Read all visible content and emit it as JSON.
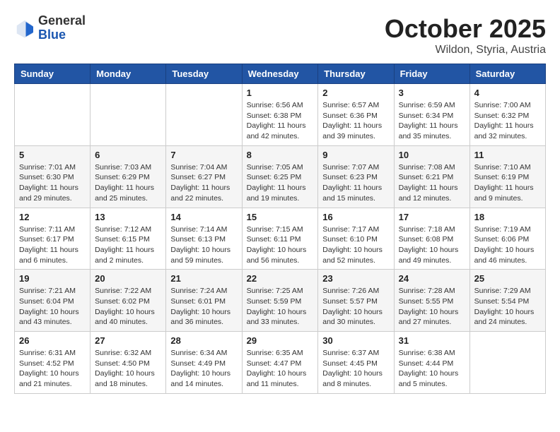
{
  "header": {
    "logo_general": "General",
    "logo_blue": "Blue",
    "month": "October 2025",
    "location": "Wildon, Styria, Austria"
  },
  "weekdays": [
    "Sunday",
    "Monday",
    "Tuesday",
    "Wednesday",
    "Thursday",
    "Friday",
    "Saturday"
  ],
  "weeks": [
    [
      {
        "day": "",
        "info": ""
      },
      {
        "day": "",
        "info": ""
      },
      {
        "day": "",
        "info": ""
      },
      {
        "day": "1",
        "info": "Sunrise: 6:56 AM\nSunset: 6:38 PM\nDaylight: 11 hours and 42 minutes."
      },
      {
        "day": "2",
        "info": "Sunrise: 6:57 AM\nSunset: 6:36 PM\nDaylight: 11 hours and 39 minutes."
      },
      {
        "day": "3",
        "info": "Sunrise: 6:59 AM\nSunset: 6:34 PM\nDaylight: 11 hours and 35 minutes."
      },
      {
        "day": "4",
        "info": "Sunrise: 7:00 AM\nSunset: 6:32 PM\nDaylight: 11 hours and 32 minutes."
      }
    ],
    [
      {
        "day": "5",
        "info": "Sunrise: 7:01 AM\nSunset: 6:30 PM\nDaylight: 11 hours and 29 minutes."
      },
      {
        "day": "6",
        "info": "Sunrise: 7:03 AM\nSunset: 6:29 PM\nDaylight: 11 hours and 25 minutes."
      },
      {
        "day": "7",
        "info": "Sunrise: 7:04 AM\nSunset: 6:27 PM\nDaylight: 11 hours and 22 minutes."
      },
      {
        "day": "8",
        "info": "Sunrise: 7:05 AM\nSunset: 6:25 PM\nDaylight: 11 hours and 19 minutes."
      },
      {
        "day": "9",
        "info": "Sunrise: 7:07 AM\nSunset: 6:23 PM\nDaylight: 11 hours and 15 minutes."
      },
      {
        "day": "10",
        "info": "Sunrise: 7:08 AM\nSunset: 6:21 PM\nDaylight: 11 hours and 12 minutes."
      },
      {
        "day": "11",
        "info": "Sunrise: 7:10 AM\nSunset: 6:19 PM\nDaylight: 11 hours and 9 minutes."
      }
    ],
    [
      {
        "day": "12",
        "info": "Sunrise: 7:11 AM\nSunset: 6:17 PM\nDaylight: 11 hours and 6 minutes."
      },
      {
        "day": "13",
        "info": "Sunrise: 7:12 AM\nSunset: 6:15 PM\nDaylight: 11 hours and 2 minutes."
      },
      {
        "day": "14",
        "info": "Sunrise: 7:14 AM\nSunset: 6:13 PM\nDaylight: 10 hours and 59 minutes."
      },
      {
        "day": "15",
        "info": "Sunrise: 7:15 AM\nSunset: 6:11 PM\nDaylight: 10 hours and 56 minutes."
      },
      {
        "day": "16",
        "info": "Sunrise: 7:17 AM\nSunset: 6:10 PM\nDaylight: 10 hours and 52 minutes."
      },
      {
        "day": "17",
        "info": "Sunrise: 7:18 AM\nSunset: 6:08 PM\nDaylight: 10 hours and 49 minutes."
      },
      {
        "day": "18",
        "info": "Sunrise: 7:19 AM\nSunset: 6:06 PM\nDaylight: 10 hours and 46 minutes."
      }
    ],
    [
      {
        "day": "19",
        "info": "Sunrise: 7:21 AM\nSunset: 6:04 PM\nDaylight: 10 hours and 43 minutes."
      },
      {
        "day": "20",
        "info": "Sunrise: 7:22 AM\nSunset: 6:02 PM\nDaylight: 10 hours and 40 minutes."
      },
      {
        "day": "21",
        "info": "Sunrise: 7:24 AM\nSunset: 6:01 PM\nDaylight: 10 hours and 36 minutes."
      },
      {
        "day": "22",
        "info": "Sunrise: 7:25 AM\nSunset: 5:59 PM\nDaylight: 10 hours and 33 minutes."
      },
      {
        "day": "23",
        "info": "Sunrise: 7:26 AM\nSunset: 5:57 PM\nDaylight: 10 hours and 30 minutes."
      },
      {
        "day": "24",
        "info": "Sunrise: 7:28 AM\nSunset: 5:55 PM\nDaylight: 10 hours and 27 minutes."
      },
      {
        "day": "25",
        "info": "Sunrise: 7:29 AM\nSunset: 5:54 PM\nDaylight: 10 hours and 24 minutes."
      }
    ],
    [
      {
        "day": "26",
        "info": "Sunrise: 6:31 AM\nSunset: 4:52 PM\nDaylight: 10 hours and 21 minutes."
      },
      {
        "day": "27",
        "info": "Sunrise: 6:32 AM\nSunset: 4:50 PM\nDaylight: 10 hours and 18 minutes."
      },
      {
        "day": "28",
        "info": "Sunrise: 6:34 AM\nSunset: 4:49 PM\nDaylight: 10 hours and 14 minutes."
      },
      {
        "day": "29",
        "info": "Sunrise: 6:35 AM\nSunset: 4:47 PM\nDaylight: 10 hours and 11 minutes."
      },
      {
        "day": "30",
        "info": "Sunrise: 6:37 AM\nSunset: 4:45 PM\nDaylight: 10 hours and 8 minutes."
      },
      {
        "day": "31",
        "info": "Sunrise: 6:38 AM\nSunset: 4:44 PM\nDaylight: 10 hours and 5 minutes."
      },
      {
        "day": "",
        "info": ""
      }
    ]
  ]
}
